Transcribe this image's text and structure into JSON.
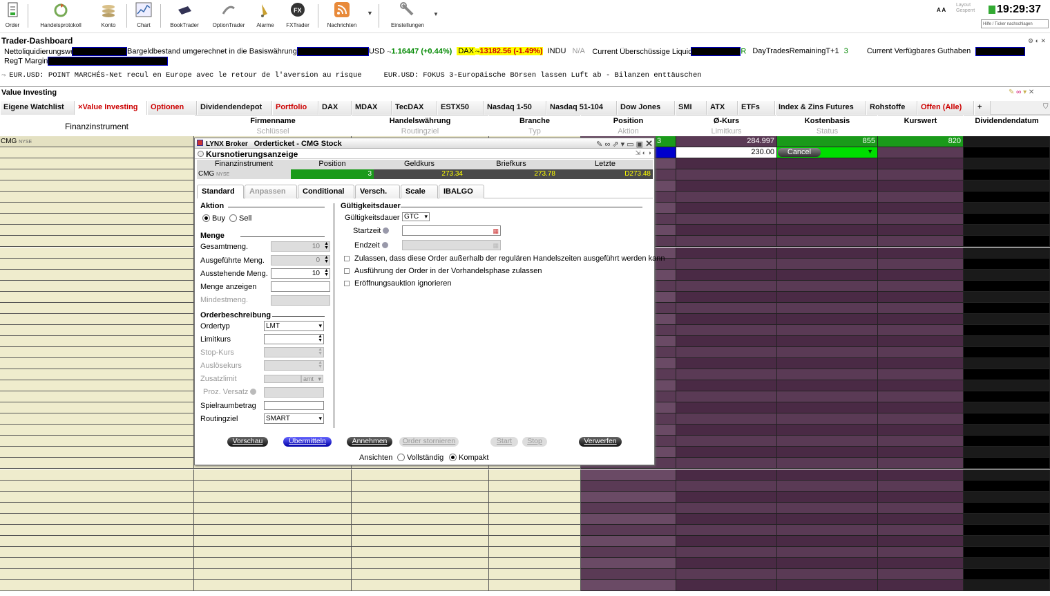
{
  "toolbar": {
    "items": [
      {
        "label": "Order",
        "icon": "order-icon"
      },
      {
        "label": "Handelsprotokoll",
        "icon": "trade-log-icon"
      },
      {
        "label": "Konto",
        "icon": "account-icon"
      },
      {
        "label": "Chart",
        "icon": "chart-icon"
      },
      {
        "label": "BookTrader",
        "icon": "booktrader-icon"
      },
      {
        "label": "OptionTrader",
        "icon": "optiontrader-icon"
      },
      {
        "label": "Alarme",
        "icon": "alarm-bell-icon"
      },
      {
        "label": "FXTrader",
        "icon": "fx-icon"
      },
      {
        "label": "Nachrichten",
        "icon": "rss-icon"
      },
      {
        "label": "Einstellungen",
        "icon": "wrench-icon"
      }
    ],
    "font_size_label": "A A",
    "layout_label": "Layout",
    "layout_state": "Gesperrt",
    "clock": "19:29:37",
    "search_placeholder": "Hilfe / Ticker nachschlagen"
  },
  "dashboard": {
    "title": "Trader-Dashboard",
    "net_liq_label": "Nettoliquidierungswert",
    "cash_label": "Bargeldbestand umgerechnet in die Basiswährung",
    "currency": "USD",
    "eurusd_value": "1.16447 (+0.44%)",
    "dax_label": "DAX",
    "dax_value": "13182.56 (-1.49%)",
    "indu_label": "INDU",
    "indu_value": "N/A",
    "excess_label": "Current Überschüssige Liquidität",
    "excess_suffix": "R",
    "daytrades_label": "DayTradesRemainingT+1",
    "daytrades_value": "3",
    "available_label": "Current Verfügbares Guthaben",
    "regt_label": "RegT Margin"
  },
  "news": {
    "item1": "EUR.USD: POINT MARCHÉS-Net recul en Europe avec le retour de l'aversion au risque",
    "item2": "EUR.USD: FOKUS 3-Europäische Börsen lassen Luft ab - Bilanzen enttäuschen"
  },
  "panel": {
    "title": "Value Investing",
    "tabs": [
      "Eigene Watchlist",
      "Value Investing",
      "Optionen",
      "Dividendendepot",
      "Portfolio",
      "DAX",
      "MDAX",
      "TecDAX",
      "ESTX50",
      "Nasdaq 1-50",
      "Nasdaq 51-104",
      "Dow Jones",
      "SMI",
      "ATX",
      "ETFs",
      "Index & Zins Futures",
      "Rohstoffe",
      "Offen (Alle)",
      "+"
    ],
    "close_tab_mark": "×",
    "columns": {
      "instrument": "Finanzinstrument",
      "company": "Firmenname",
      "key": "Schlüssel",
      "currency": "Handelswährung",
      "route": "Routingziel",
      "sector": "Branche",
      "type": "Typ",
      "position": "Position",
      "action": "Aktion",
      "avg": "Ø-Kurs",
      "limit": "Limitkurs",
      "cost": "Kostenbasis",
      "status": "Status",
      "price": "Kurswert",
      "dividend": "Dividendendatum"
    },
    "row": {
      "symbol": "CMG",
      "exchange": "NYSE",
      "position": "3",
      "avg_price": "284.997",
      "cost_basis": "855",
      "market_value": "820"
    },
    "order_row": {
      "limit": "230.00",
      "status": "Cancel"
    }
  },
  "dialog": {
    "brand": "LYNX Broker",
    "title": "Orderticket - CMG Stock",
    "subtitle": "Kursnotierungsanzeige",
    "quote_headers": [
      "Finanzinstrument",
      "Position",
      "Geldkurs",
      "Briefkurs",
      "Letzte"
    ],
    "quote": {
      "symbol": "CMG",
      "exchange": "NYSE",
      "position": "3",
      "bid": "273.34",
      "ask": "273.78",
      "last": "D273.48"
    },
    "tabs": [
      "Standard",
      "Anpassen",
      "Conditional",
      "Versch.",
      "Scale",
      "IBALGO"
    ],
    "aktion": {
      "title": "Aktion",
      "buy": "Buy",
      "sell": "Sell"
    },
    "menge": {
      "title": "Menge",
      "total_label": "Gesamtmeng.",
      "total": "10",
      "filled_label": "Ausgeführte Meng.",
      "filled": "0",
      "open_label": "Ausstehende Meng.",
      "open": "10",
      "display_label": "Menge anzeigen",
      "min_label": "Mindestmeng."
    },
    "order": {
      "title": "Orderbeschreibung",
      "type_label": "Ordertyp",
      "type": "LMT",
      "limit_label": "Limitkurs",
      "stop_label": "Stop-Kurs",
      "trigger_label": "Auslösekurs",
      "extra_label": "Zusatzlimit",
      "extra_unit": "amt",
      "offset_label": "Proz. Versatz",
      "range_label": "Spielraumbetrag",
      "route_label": "Routingziel",
      "route": "SMART"
    },
    "validity": {
      "title": "Gültigkeitsdauer",
      "label": "Gültigkeitsdauer",
      "value": "GTC",
      "start_label": "Startzeit",
      "end_label": "Endzeit",
      "opt1": "Zulassen, dass diese Order außerhalb der regulären Handelszeiten ausgeführt werden kann",
      "opt2": "Ausführung der Order in der Vorhandelsphase zulassen",
      "opt3": "Eröffnungsauktion ignorieren"
    },
    "buttons": {
      "preview": "Vorschau",
      "submit": "Übermitteln",
      "accept": "Annehmen",
      "cancel_order": "Order stornieren",
      "start": "Start",
      "stop": "Stop",
      "discard": "Verwerfen"
    },
    "view": {
      "label": "Ansichten",
      "full": "Vollständig",
      "compact": "Kompakt"
    }
  },
  "colors": {
    "cream": "#efeccd",
    "purple": "#4a2a45",
    "green": "#00aa00",
    "grey": "#4a4a4a",
    "accent_red": "#cc0000"
  }
}
